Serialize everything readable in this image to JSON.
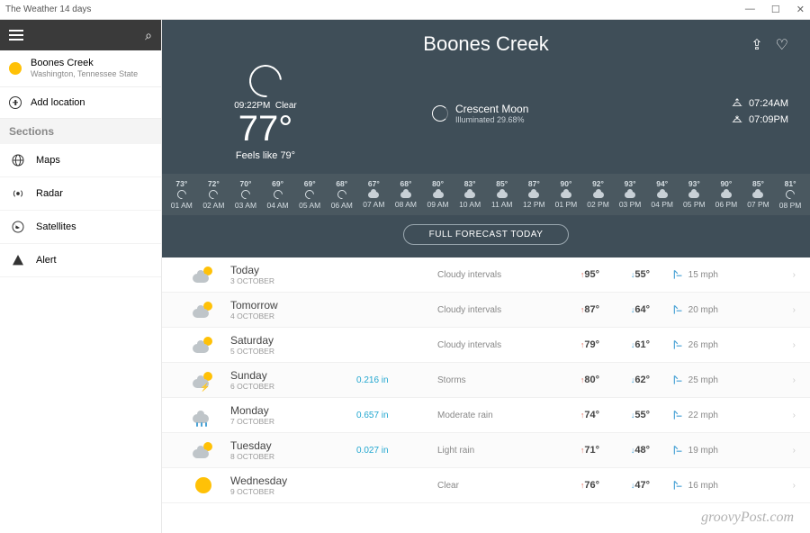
{
  "window": {
    "title": "The Weather 14 days"
  },
  "sidebar": {
    "location": {
      "name": "Boones Creek",
      "region": "Washington, Tennessee State"
    },
    "add_label": "Add location",
    "sections_label": "Sections",
    "items": [
      {
        "label": "Maps"
      },
      {
        "label": "Radar"
      },
      {
        "label": "Satellites"
      },
      {
        "label": "Alert"
      }
    ]
  },
  "hero": {
    "city": "Boones Creek",
    "time": "09:22PM",
    "condition": "Clear",
    "temp": "77°",
    "feels": "Feels like 79°",
    "moon_phase": "Crescent Moon",
    "moon_illum": "Illuminated 29.68%",
    "sunrise": "07:24AM",
    "sunset": "07:09PM"
  },
  "hourly": [
    {
      "t": "73°",
      "h": "01 AM",
      "k": "moon"
    },
    {
      "t": "72°",
      "h": "02 AM",
      "k": "moon"
    },
    {
      "t": "70°",
      "h": "03 AM",
      "k": "moon"
    },
    {
      "t": "69°",
      "h": "04 AM",
      "k": "moon"
    },
    {
      "t": "69°",
      "h": "05 AM",
      "k": "moon"
    },
    {
      "t": "68°",
      "h": "06 AM",
      "k": "moon"
    },
    {
      "t": "67°",
      "h": "07 AM",
      "k": "cloud"
    },
    {
      "t": "68°",
      "h": "08 AM",
      "k": "cloud"
    },
    {
      "t": "80°",
      "h": "09 AM",
      "k": "cloud"
    },
    {
      "t": "83°",
      "h": "10 AM",
      "k": "cloud"
    },
    {
      "t": "85°",
      "h": "11 AM",
      "k": "cloud"
    },
    {
      "t": "87°",
      "h": "12 PM",
      "k": "cloud"
    },
    {
      "t": "90°",
      "h": "01 PM",
      "k": "cloud"
    },
    {
      "t": "92°",
      "h": "02 PM",
      "k": "cloud"
    },
    {
      "t": "93°",
      "h": "03 PM",
      "k": "cloud"
    },
    {
      "t": "94°",
      "h": "04 PM",
      "k": "cloud"
    },
    {
      "t": "93°",
      "h": "05 PM",
      "k": "cloud"
    },
    {
      "t": "90°",
      "h": "06 PM",
      "k": "cloud"
    },
    {
      "t": "85°",
      "h": "07 PM",
      "k": "cloud"
    },
    {
      "t": "81°",
      "h": "08 PM",
      "k": "moon"
    }
  ],
  "full_forecast_label": "FULL FORECAST TODAY",
  "forecast": [
    {
      "day": "Today",
      "date": "3 OCTOBER",
      "precip": "",
      "desc": "Cloudy intervals",
      "hi": "95°",
      "lo": "55°",
      "wind": "15 mph",
      "icon": "suncloud"
    },
    {
      "day": "Tomorrow",
      "date": "4 OCTOBER",
      "precip": "",
      "desc": "Cloudy intervals",
      "hi": "87°",
      "lo": "64°",
      "wind": "20 mph",
      "icon": "suncloud"
    },
    {
      "day": "Saturday",
      "date": "5 OCTOBER",
      "precip": "",
      "desc": "Cloudy intervals",
      "hi": "79°",
      "lo": "61°",
      "wind": "26 mph",
      "icon": "suncloud"
    },
    {
      "day": "Sunday",
      "date": "6 OCTOBER",
      "precip": "0.216 in",
      "desc": "Storms",
      "hi": "80°",
      "lo": "62°",
      "wind": "25 mph",
      "icon": "storm"
    },
    {
      "day": "Monday",
      "date": "7 OCTOBER",
      "precip": "0.657 in",
      "desc": "Moderate rain",
      "hi": "74°",
      "lo": "55°",
      "wind": "22 mph",
      "icon": "rain"
    },
    {
      "day": "Tuesday",
      "date": "8 OCTOBER",
      "precip": "0.027 in",
      "desc": "Light rain",
      "hi": "71°",
      "lo": "48°",
      "wind": "19 mph",
      "icon": "suncloud"
    },
    {
      "day": "Wednesday",
      "date": "9 OCTOBER",
      "precip": "",
      "desc": "Clear",
      "hi": "76°",
      "lo": "47°",
      "wind": "16 mph",
      "icon": "sun"
    }
  ],
  "watermark": "groovyPost.com"
}
